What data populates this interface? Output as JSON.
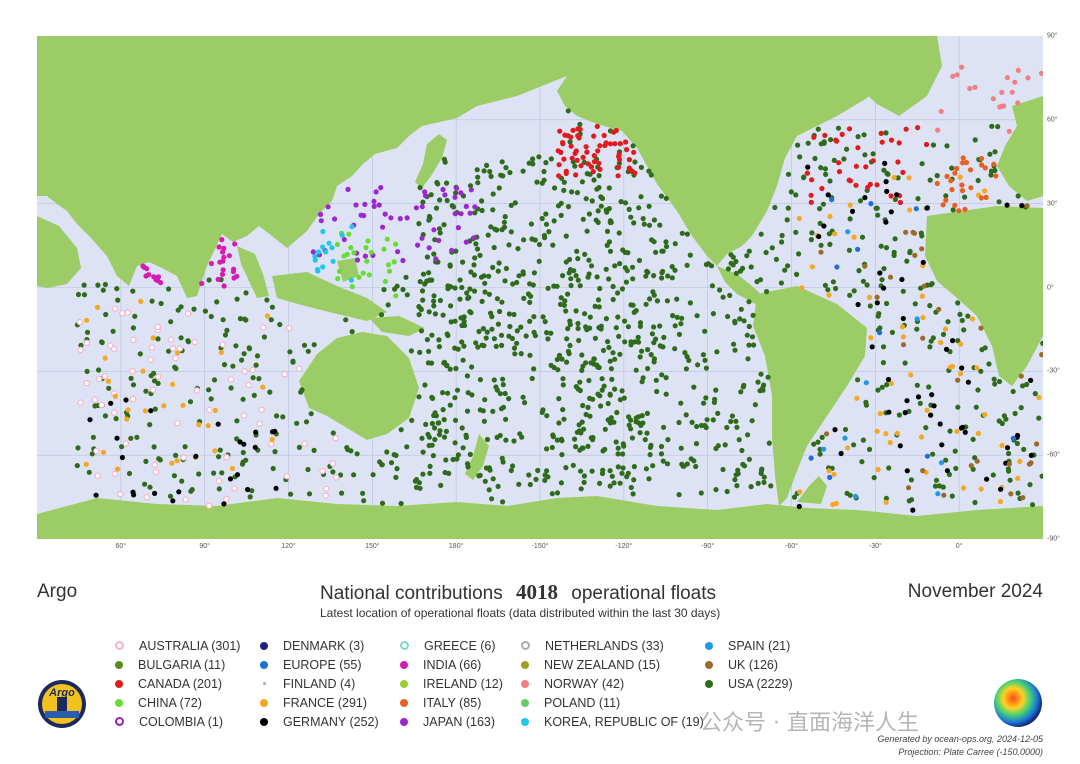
{
  "header": {
    "program": "Argo",
    "title_prefix": "National contributions",
    "total_floats": "4018",
    "title_suffix": "operational floats",
    "date": "November 2024",
    "subtitle": "Latest location of operational floats (data distributed within the last 30 days)"
  },
  "map": {
    "projection_center_lon": -150,
    "lon_ticks": [
      "60°",
      "90°",
      "120°",
      "150°",
      "180°",
      "-150°",
      "-120°",
      "-90°",
      "-60°",
      "-30°",
      "0°"
    ],
    "lat_ticks": [
      "90°",
      "60°",
      "30°",
      "0°",
      "-30°",
      "-60°",
      "-90°"
    ],
    "colors": {
      "land": "#9ccc65",
      "ocean": "#dde3f5",
      "grid": "#b8c2dc"
    }
  },
  "legend": [
    {
      "label": "AUSTRALIA (301)",
      "color": "#f5b3c8",
      "style": "ring"
    },
    {
      "label": "BULGARIA (11)",
      "color": "#5b8a1e",
      "style": "dot"
    },
    {
      "label": "CANADA (201)",
      "color": "#e31a1c",
      "style": "dot"
    },
    {
      "label": "CHINA (72)",
      "color": "#66dd33",
      "style": "dot"
    },
    {
      "label": "COLOMBIA (1)",
      "color": "#8e24aa",
      "style": "ring"
    },
    {
      "label": "DENMARK (3)",
      "color": "#1a237e",
      "style": "dot"
    },
    {
      "label": "EUROPE (55)",
      "color": "#1e6fd9",
      "style": "dot"
    },
    {
      "label": "FINLAND (4)",
      "color": "#aaaaaa",
      "style": "tiny"
    },
    {
      "label": "FRANCE (291)",
      "color": "#f5a623",
      "style": "dot"
    },
    {
      "label": "GERMANY (252)",
      "color": "#000000",
      "style": "dot"
    },
    {
      "label": "GREECE (6)",
      "color": "#7fd8c8",
      "style": "ring"
    },
    {
      "label": "INDIA (66)",
      "color": "#d81bb0",
      "style": "dot"
    },
    {
      "label": "IRELAND (12)",
      "color": "#9acd32",
      "style": "dot"
    },
    {
      "label": "ITALY (85)",
      "color": "#e8601c",
      "style": "dot"
    },
    {
      "label": "JAPAN (163)",
      "color": "#9c27d0",
      "style": "dot"
    },
    {
      "label": "NETHERLANDS (33)",
      "color": "#aaaaaa",
      "style": "ring"
    },
    {
      "label": "NEW ZEALAND (15)",
      "color": "#a0a020",
      "style": "dot"
    },
    {
      "label": "NORWAY (42)",
      "color": "#f08080",
      "style": "dot"
    },
    {
      "label": "POLAND (11)",
      "color": "#66cc66",
      "style": "dot"
    },
    {
      "label": "KOREA, REPUBLIC OF (19)",
      "color": "#1ec8e6",
      "style": "dot"
    },
    {
      "label": "SPAIN (21)",
      "color": "#1e9be6",
      "style": "dot"
    },
    {
      "label": "UK (126)",
      "color": "#9b6a28",
      "style": "dot"
    },
    {
      "label": "USA (2229)",
      "color": "#2e6b1a",
      "style": "dot"
    }
  ],
  "credits": {
    "generated": "Generated by ocean-ops.org, 2024-12-05",
    "projection": "Projection: Plate Carree (-150.0000)"
  },
  "logo_text": "Argo",
  "watermark": "公众号 · 直面海洋人生"
}
